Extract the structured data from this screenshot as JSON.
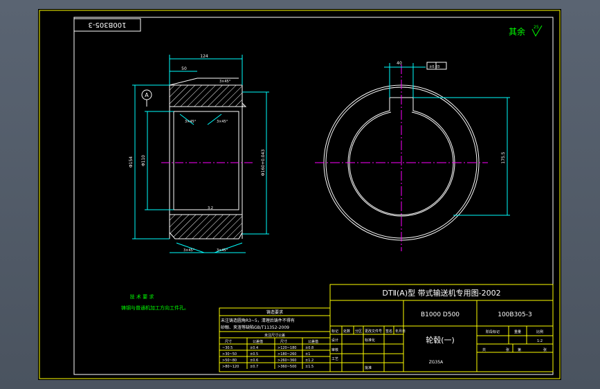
{
  "drawing_number": "100B305-3",
  "surface_finish": {
    "label": "其余",
    "value": "25"
  },
  "dimensions": {
    "overall_length": "124",
    "hub_length": "50",
    "chamfer_top": "3×45°",
    "chamfer_inner_left": "3×45°",
    "chamfer_inner_right": "3×45°",
    "chamfer_bottom_left": "3×45°",
    "chamfer_bottom_right": "3×45°",
    "roughness_top": "3.2",
    "roughness_bore": "3.2",
    "outer_diameter": "Φ154",
    "bore_diameter": "Φ110",
    "bore_tolerance": "Φ160+0.043",
    "keyway_width": "40",
    "keyway_tol": "±0.03",
    "keyway_depth": "175.5",
    "datum": "A"
  },
  "tech_requirements": {
    "title": "技 术 要 求",
    "line1": "铸钢与普通机加工方向工件孔。"
  },
  "spec_table": {
    "title": "铸造要求",
    "line1": "未注铸造圆角R3~5，清理后铸件不得有",
    "line2": "砂眼、夹渣等缺陷GB/T11352-2009",
    "subtitle": "未注尺寸公差",
    "headers": [
      "尺寸",
      "公差值",
      "尺寸",
      "公差值"
    ],
    "rows": [
      [
        "~30.5",
        "±0.4",
        ">120~180",
        "±0.8"
      ],
      [
        ">30~50",
        "±0.5",
        ">180~260",
        "±1"
      ],
      [
        ">50~80",
        "±0.6",
        ">260~360",
        "±1.2"
      ],
      [
        ">80~120",
        "±0.7",
        ">360~500",
        "±1.5"
      ]
    ]
  },
  "title_block": {
    "heading": "DTⅡ(A)型  带式输送机专用图-2002",
    "model": "B1000 D500",
    "drawing_no": "100B305-3",
    "part_name": "轮毂(一)",
    "material": "ZG35A",
    "label_stage": "阶段标记",
    "label_weight": "重量",
    "label_scale": "比例",
    "scale": "1:2",
    "label_sheet": "共",
    "label_sheet_of": "张",
    "label_page": "第",
    "label_page_of": "张",
    "rev_headers": [
      "标记",
      "处数",
      "分区",
      "更改文件号",
      "签名",
      "年月日"
    ],
    "label_design": "设计",
    "label_std": "标准化",
    "label_check": "审核",
    "label_process": "工艺",
    "label_approve": "批准"
  }
}
